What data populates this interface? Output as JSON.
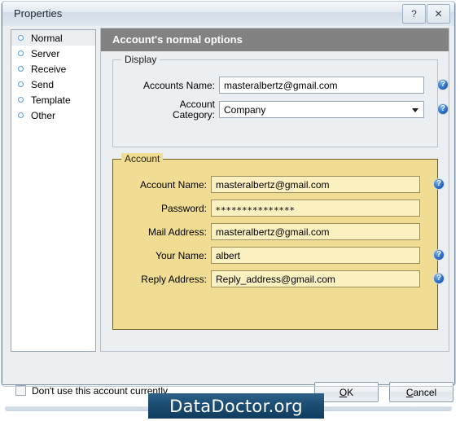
{
  "window": {
    "title": "Properties",
    "help_button": "?",
    "close_button": "✕"
  },
  "sidebar": {
    "items": [
      {
        "label": "Normal",
        "selected": true
      },
      {
        "label": "Server",
        "selected": false
      },
      {
        "label": "Receive",
        "selected": false
      },
      {
        "label": "Send",
        "selected": false
      },
      {
        "label": "Template",
        "selected": false
      },
      {
        "label": "Other",
        "selected": false
      }
    ]
  },
  "panel": {
    "banner_title": "Account's normal options",
    "display_group": {
      "legend": "Display",
      "fields": [
        {
          "label": "Accounts Name:",
          "value": "masteralbertz@gmail.com",
          "type": "text",
          "help": "?"
        },
        {
          "label_line1": "Account",
          "label_line2": "Category:",
          "value": "Company",
          "type": "combo",
          "help": "?"
        }
      ]
    },
    "account_group": {
      "legend": "Account",
      "fields": [
        {
          "label": "Account Name:",
          "value": "masteralbertz@gmail.com",
          "type": "text",
          "help": "?"
        },
        {
          "label": "Password:",
          "value": "***************",
          "type": "password",
          "help": ""
        },
        {
          "label": "Mail Address:",
          "value": "masteralbertz@gmail.com",
          "type": "text",
          "help": ""
        },
        {
          "label": "Your Name:",
          "value": "albert",
          "type": "text",
          "help": "?"
        },
        {
          "label": "Reply Address:",
          "value": "Reply_address@gmail.com",
          "type": "text",
          "help": "?"
        }
      ]
    }
  },
  "footer": {
    "checkbox_label": "Don't use this account currently",
    "checkbox_checked": false,
    "ok_accel": "O",
    "ok_rest": "K",
    "cancel_accel": "C",
    "cancel_rest": "ancel"
  },
  "watermark": {
    "text": "DataDoctor.org"
  },
  "colors": {
    "banner": "#828282",
    "account_group_fill": "#f0dd93",
    "account_field_fill": "#fbf0c0",
    "accent_help": "#2f6fc4",
    "watermark_bg": "#1d4f75"
  }
}
